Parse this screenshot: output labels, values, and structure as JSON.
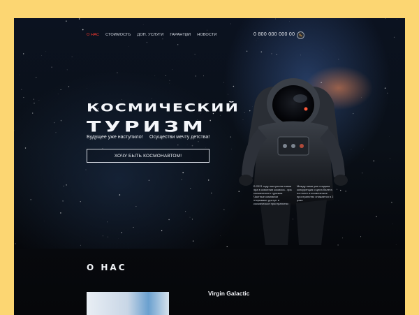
{
  "nav": {
    "items": [
      {
        "label": "О НАС",
        "active": true
      },
      {
        "label": "СТОИМОСТЬ",
        "active": false
      },
      {
        "label": "ДОП. УСЛУГИ",
        "active": false
      },
      {
        "label": "ГАРАНТИИ",
        "active": false
      },
      {
        "label": "НОВОСТИ",
        "active": false
      }
    ],
    "phone": "0 800 000 000 00",
    "phone_icon": "phone-icon"
  },
  "hero": {
    "title_line1": "Космический",
    "title_line2": "Туризм",
    "tagline_left": "Будущее уже наступило!",
    "tagline_right": "Осуществи мечту детства!",
    "cta_label": "ХОЧУ БЫТЬ КОСМОНАВТОМ!"
  },
  "info": {
    "col1": "В 2021 году наступила новая эра в освоении космоса - эра космического туризма. Частные компании открывают доступ в космическое пространство",
    "col2": "Между ними уже создана конкуренция и цена билета на полет в космическое пространство снижается в 2 раза"
  },
  "about": {
    "title": "О НАС",
    "company": "Virgin Galactic"
  },
  "colors": {
    "frame_bg": "#fcd672",
    "accent": "#ff3b30",
    "page_bg": "#05070c"
  }
}
